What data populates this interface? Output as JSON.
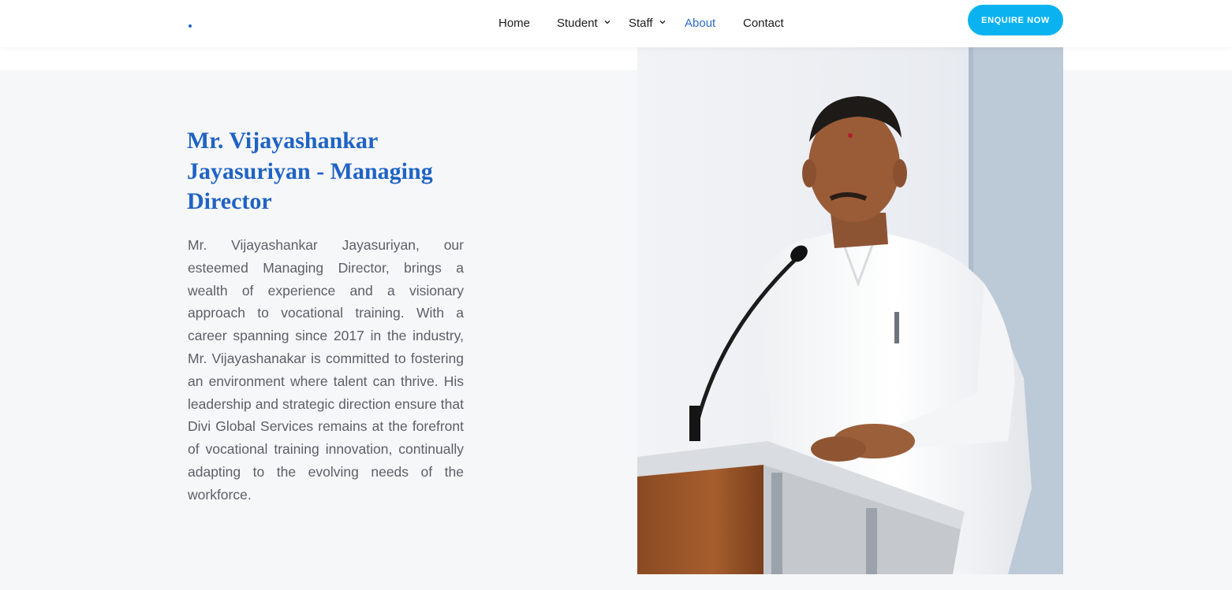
{
  "header": {
    "logo": ".",
    "nav": [
      {
        "label": "Home",
        "has_dropdown": false,
        "active": false
      },
      {
        "label": "Student",
        "has_dropdown": true,
        "active": false
      },
      {
        "label": "Staff",
        "has_dropdown": true,
        "active": false
      },
      {
        "label": "About",
        "has_dropdown": false,
        "active": true
      },
      {
        "label": "Contact",
        "has_dropdown": false,
        "active": false
      }
    ],
    "cta_label": "ENQUIRE NOW"
  },
  "profile": {
    "heading": "Mr. Vijayashankar Jayasuriyan - Managing Director",
    "bio": "Mr. Vijayashankar Jayasuriyan, our esteemed Managing Director, brings a wealth of experience and a visionary approach to vocational training. With a career spanning since 2017 in the industry, Mr. Vijayashanakar is committed to fostering an environment where talent can thrive. His leadership and strategic direction ensure that Divi Global Services remains at the forefront of vocational training innovation, continually adapting to the evolving needs of the workforce."
  },
  "colors": {
    "accent": "#1f63c4",
    "nav_active": "#2c6ac9",
    "cta_bg": "#0ab3f0",
    "section_bg": "#f6f7f9",
    "body_text": "#5b5f66"
  },
  "icons": {
    "dropdown": "chevron-down-icon"
  }
}
